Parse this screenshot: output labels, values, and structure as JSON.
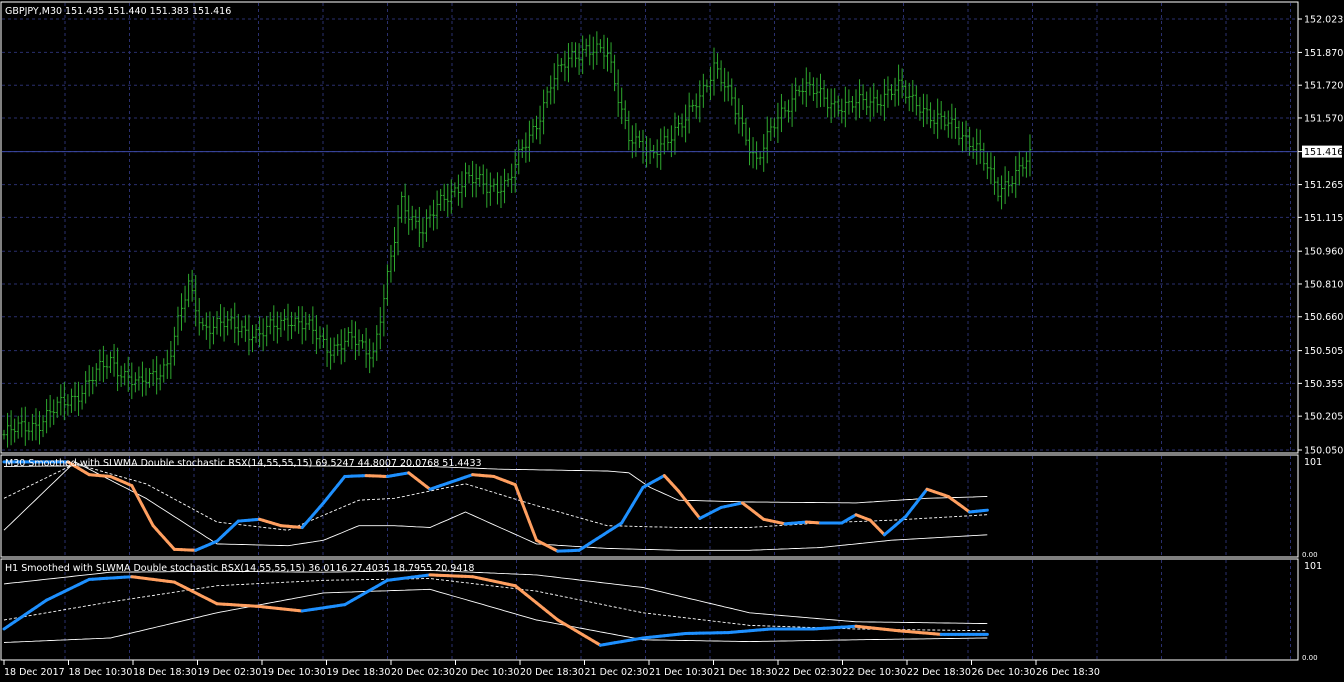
{
  "window": {
    "main_header": "GBPJPY,M30  151.435 151.440 151.383 151.416",
    "sub1_header": "M30 Smoothed with SLWMA  Double stochastic RSX(14,55,55,15) 69.5247 44.8007 20.0768 51.4433",
    "sub2_header": "H1 Smoothed with SLWMA  Double stochastic RSX(14,55,55,15) 36.0116 27.4035 18.7955 20.9418"
  },
  "colors": {
    "background": "#000000",
    "grid": "#2a2f6e",
    "axis": "#ffffff",
    "bars": "#2ea82e",
    "rsx_up": "#1e90ff",
    "rsx_down": "#ff9f60",
    "bands": "#ffffff"
  },
  "chart_data": [
    {
      "type": "ohlc",
      "symbol": "GBPJPY",
      "timeframe": "M30",
      "last_price": "151.416",
      "ylim": [
        150.05,
        152.07
      ],
      "y_ticks": [
        "152.023",
        "151.870",
        "151.720",
        "151.570",
        "151.416",
        "151.265",
        "151.115",
        "150.960",
        "150.810",
        "150.660",
        "150.505",
        "150.355",
        "150.205",
        "150.050"
      ],
      "x_ticks": [
        "18 Dec 2017",
        "18 Dec 10:30",
        "18 Dec 18:30",
        "19 Dec 02:30",
        "19 Dec 10:30",
        "19 Dec 18:30",
        "20 Dec 02:30",
        "20 Dec 10:30",
        "20 Dec 18:30",
        "21 Dec 02:30",
        "21 Dec 10:30",
        "21 Dec 18:30",
        "22 Dec 02:30",
        "22 Dec 10:30",
        "22 Dec 18:30",
        "26 Dec 10:30",
        "26 Dec 18:30"
      ],
      "close_path": [
        [
          0,
          150.12
        ],
        [
          10,
          150.18
        ],
        [
          20,
          150.3
        ],
        [
          30,
          150.46
        ],
        [
          38,
          150.34
        ],
        [
          46,
          150.45
        ],
        [
          52,
          150.8
        ],
        [
          56,
          150.62
        ],
        [
          66,
          150.62
        ],
        [
          72,
          150.57
        ],
        [
          80,
          150.66
        ],
        [
          86,
          150.6
        ],
        [
          92,
          150.52
        ],
        [
          98,
          150.55
        ],
        [
          104,
          150.5
        ],
        [
          108,
          150.83
        ],
        [
          112,
          151.18
        ],
        [
          118,
          151.06
        ],
        [
          124,
          151.2
        ],
        [
          130,
          151.3
        ],
        [
          136,
          151.25
        ],
        [
          142,
          151.28
        ],
        [
          150,
          151.55
        ],
        [
          154,
          151.73
        ],
        [
          160,
          151.85
        ],
        [
          164,
          151.9
        ],
        [
          170,
          151.85
        ],
        [
          176,
          151.5
        ],
        [
          182,
          151.38
        ],
        [
          186,
          151.48
        ],
        [
          192,
          151.55
        ],
        [
          196,
          151.67
        ],
        [
          200,
          151.82
        ],
        [
          206,
          151.6
        ],
        [
          212,
          151.38
        ],
        [
          218,
          151.56
        ],
        [
          224,
          151.72
        ],
        [
          232,
          151.65
        ],
        [
          238,
          151.62
        ],
        [
          246,
          151.66
        ],
        [
          252,
          151.7
        ],
        [
          258,
          151.64
        ],
        [
          262,
          151.55
        ],
        [
          268,
          151.54
        ],
        [
          274,
          151.42
        ],
        [
          280,
          151.25
        ],
        [
          286,
          151.32
        ],
        [
          290,
          151.41
        ]
      ]
    },
    {
      "type": "line",
      "name": "M30 Smoothed with SLWMA  Double stochastic RSX(14,55,55,15)",
      "ylim": [
        0,
        101
      ],
      "y_ticks": [
        "101",
        "0.00"
      ],
      "rsx": [
        [
          0,
          100
        ],
        [
          10,
          100
        ],
        [
          18,
          100
        ],
        [
          24,
          86
        ],
        [
          30,
          84
        ],
        [
          36,
          74
        ],
        [
          42,
          30
        ],
        [
          48,
          4
        ],
        [
          54,
          3
        ],
        [
          60,
          13
        ],
        [
          66,
          35
        ],
        [
          72,
          37
        ],
        [
          78,
          30
        ],
        [
          84,
          28
        ],
        [
          90,
          55
        ],
        [
          96,
          84
        ],
        [
          102,
          85
        ],
        [
          108,
          84
        ],
        [
          114,
          88
        ],
        [
          120,
          70
        ],
        [
          126,
          78
        ],
        [
          132,
          86
        ],
        [
          138,
          84
        ],
        [
          144,
          75
        ],
        [
          150,
          14
        ],
        [
          156,
          2
        ],
        [
          162,
          3
        ],
        [
          168,
          18
        ],
        [
          174,
          33
        ],
        [
          180,
          72
        ],
        [
          186,
          85
        ],
        [
          190,
          68
        ],
        [
          196,
          38
        ],
        [
          202,
          50
        ],
        [
          208,
          55
        ],
        [
          214,
          37
        ],
        [
          220,
          32
        ],
        [
          226,
          34
        ],
        [
          230,
          33
        ],
        [
          236,
          33
        ],
        [
          240,
          42
        ],
        [
          244,
          36
        ],
        [
          248,
          20
        ],
        [
          254,
          40
        ],
        [
          260,
          70
        ],
        [
          266,
          62
        ],
        [
          272,
          45
        ],
        [
          277,
          47
        ]
      ],
      "upper_band": [
        [
          0,
          95
        ],
        [
          30,
          96
        ],
        [
          60,
          96
        ],
        [
          80,
          96
        ],
        [
          100,
          95
        ],
        [
          120,
          95
        ],
        [
          140,
          92
        ],
        [
          170,
          90
        ],
        [
          176,
          88
        ],
        [
          182,
          72
        ],
        [
          190,
          58
        ],
        [
          210,
          56
        ],
        [
          240,
          55
        ],
        [
          260,
          60
        ],
        [
          277,
          62
        ]
      ],
      "lower_band": [
        [
          0,
          25
        ],
        [
          20,
          100
        ],
        [
          40,
          60
        ],
        [
          60,
          10
        ],
        [
          80,
          8
        ],
        [
          90,
          14
        ],
        [
          100,
          30
        ],
        [
          110,
          30
        ],
        [
          120,
          28
        ],
        [
          130,
          45
        ],
        [
          150,
          10
        ],
        [
          170,
          5
        ],
        [
          190,
          3
        ],
        [
          210,
          3
        ],
        [
          230,
          6
        ],
        [
          250,
          14
        ],
        [
          277,
          20
        ]
      ],
      "middle_band": [
        [
          0,
          60
        ],
        [
          20,
          98
        ],
        [
          40,
          76
        ],
        [
          60,
          34
        ],
        [
          80,
          25
        ],
        [
          100,
          58
        ],
        [
          110,
          60
        ],
        [
          130,
          76
        ],
        [
          150,
          52
        ],
        [
          170,
          30
        ],
        [
          190,
          28
        ],
        [
          210,
          28
        ],
        [
          230,
          33
        ],
        [
          250,
          36
        ],
        [
          277,
          42
        ]
      ]
    },
    {
      "type": "line",
      "name": "H1 Smoothed with SLWMA  Double stochastic RSX(14,55,55,15)",
      "ylim": [
        0,
        101
      ],
      "y_ticks": [
        "101",
        "0.00"
      ],
      "rsx": [
        [
          0,
          30
        ],
        [
          12,
          62
        ],
        [
          24,
          85
        ],
        [
          36,
          88
        ],
        [
          48,
          82
        ],
        [
          60,
          58
        ],
        [
          72,
          55
        ],
        [
          84,
          50
        ],
        [
          96,
          57
        ],
        [
          108,
          84
        ],
        [
          120,
          90
        ],
        [
          132,
          88
        ],
        [
          144,
          78
        ],
        [
          156,
          40
        ],
        [
          168,
          12
        ],
        [
          180,
          20
        ],
        [
          192,
          25
        ],
        [
          204,
          26
        ],
        [
          216,
          30
        ],
        [
          228,
          30
        ],
        [
          240,
          33
        ],
        [
          252,
          28
        ],
        [
          264,
          24
        ],
        [
          277,
          24
        ]
      ],
      "upper_band": [
        [
          0,
          80
        ],
        [
          30,
          93
        ],
        [
          60,
          94
        ],
        [
          90,
          93
        ],
        [
          120,
          95
        ],
        [
          150,
          90
        ],
        [
          180,
          76
        ],
        [
          210,
          48
        ],
        [
          240,
          38
        ],
        [
          277,
          36
        ]
      ],
      "lower_band": [
        [
          0,
          15
        ],
        [
          30,
          20
        ],
        [
          60,
          48
        ],
        [
          90,
          70
        ],
        [
          120,
          74
        ],
        [
          150,
          40
        ],
        [
          180,
          18
        ],
        [
          210,
          16
        ],
        [
          240,
          18
        ],
        [
          277,
          20
        ]
      ],
      "middle_band": [
        [
          0,
          40
        ],
        [
          30,
          60
        ],
        [
          60,
          78
        ],
        [
          90,
          84
        ],
        [
          120,
          86
        ],
        [
          150,
          72
        ],
        [
          180,
          48
        ],
        [
          210,
          34
        ],
        [
          240,
          30
        ],
        [
          277,
          28
        ]
      ]
    }
  ]
}
